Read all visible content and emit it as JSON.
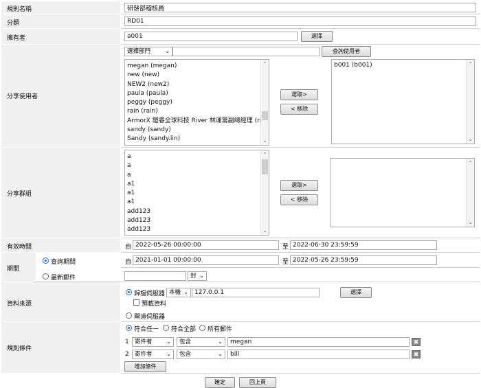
{
  "labels": {
    "rule_name": "規則名稱",
    "category": "分類",
    "owner": "擁有者",
    "share_users": "分享使用者",
    "share_groups": "分享群組",
    "valid_time": "有效時間",
    "period": "期間",
    "data_source": "資料來源",
    "rule_conditions": "規則條件"
  },
  "rule_name": {
    "value": "研發部稽核員"
  },
  "category": {
    "value": "RD01"
  },
  "owner": {
    "value": "a001",
    "select_button": "選擇"
  },
  "share_users": {
    "dept_select": "選擇部門",
    "search_value": "",
    "search_button": "查詢使用者",
    "available": [
      "megan (megan)",
      "new (new)",
      "NEW2 (new2)",
      "paula (paula)",
      "peggy (peggy)",
      "rain (rain)",
      "ArmorX 鎧睿全球科技 River 林運籌副總經理 (river)",
      "sandy (sandy)",
      "Sandy (sandy.lin)"
    ],
    "selected": [
      "b001 (b001)"
    ],
    "add_button": "選取>",
    "remove_button": "< 移除"
  },
  "share_groups": {
    "available": [
      "a",
      "a",
      "a",
      "a1",
      "a1",
      "a1",
      "add123",
      "add123",
      "add123"
    ],
    "selected": [],
    "add_button": "選取>",
    "remove_button": "< 移除"
  },
  "valid_time": {
    "from_prefix": "自",
    "from": "2022-05-26 00:00:00",
    "to_prefix": "至",
    "to": "2022-06-30 23:59:59"
  },
  "period": {
    "query_period_label": "查詢期間",
    "from_prefix": "自",
    "from": "2021-01-01 00:00:00",
    "to_prefix": "至",
    "to": "2022-05-26 23:59:59",
    "latest_mail_label": "最新郵件",
    "latest_count": "",
    "latest_unit": "封"
  },
  "data_source": {
    "archive_server_label": "歸檔伺服器",
    "server_select": "本機",
    "server_ip": "127.0.0.1",
    "select_button": "選擇",
    "preload_label": "預載資料",
    "gateway_label": "閘道伺服器"
  },
  "rule_conditions": {
    "match_any": "符合任一",
    "match_all": "符合全部",
    "all_mail": "所有郵件",
    "conditions": [
      {
        "index": "1",
        "field": "寄件者",
        "operator": "包含",
        "value": "megan"
      },
      {
        "index": "2",
        "field": "寄件者",
        "operator": "包含",
        "value": "bill"
      }
    ],
    "add_button": "增加條件"
  },
  "footer": {
    "confirm": "確定",
    "back": "回上頁"
  },
  "icons": {
    "dropdown": "chevron-down-icon",
    "delete": "delete-x-icon",
    "scroll_up": "scroll-up-icon",
    "scroll_down": "scroll-down-icon"
  }
}
